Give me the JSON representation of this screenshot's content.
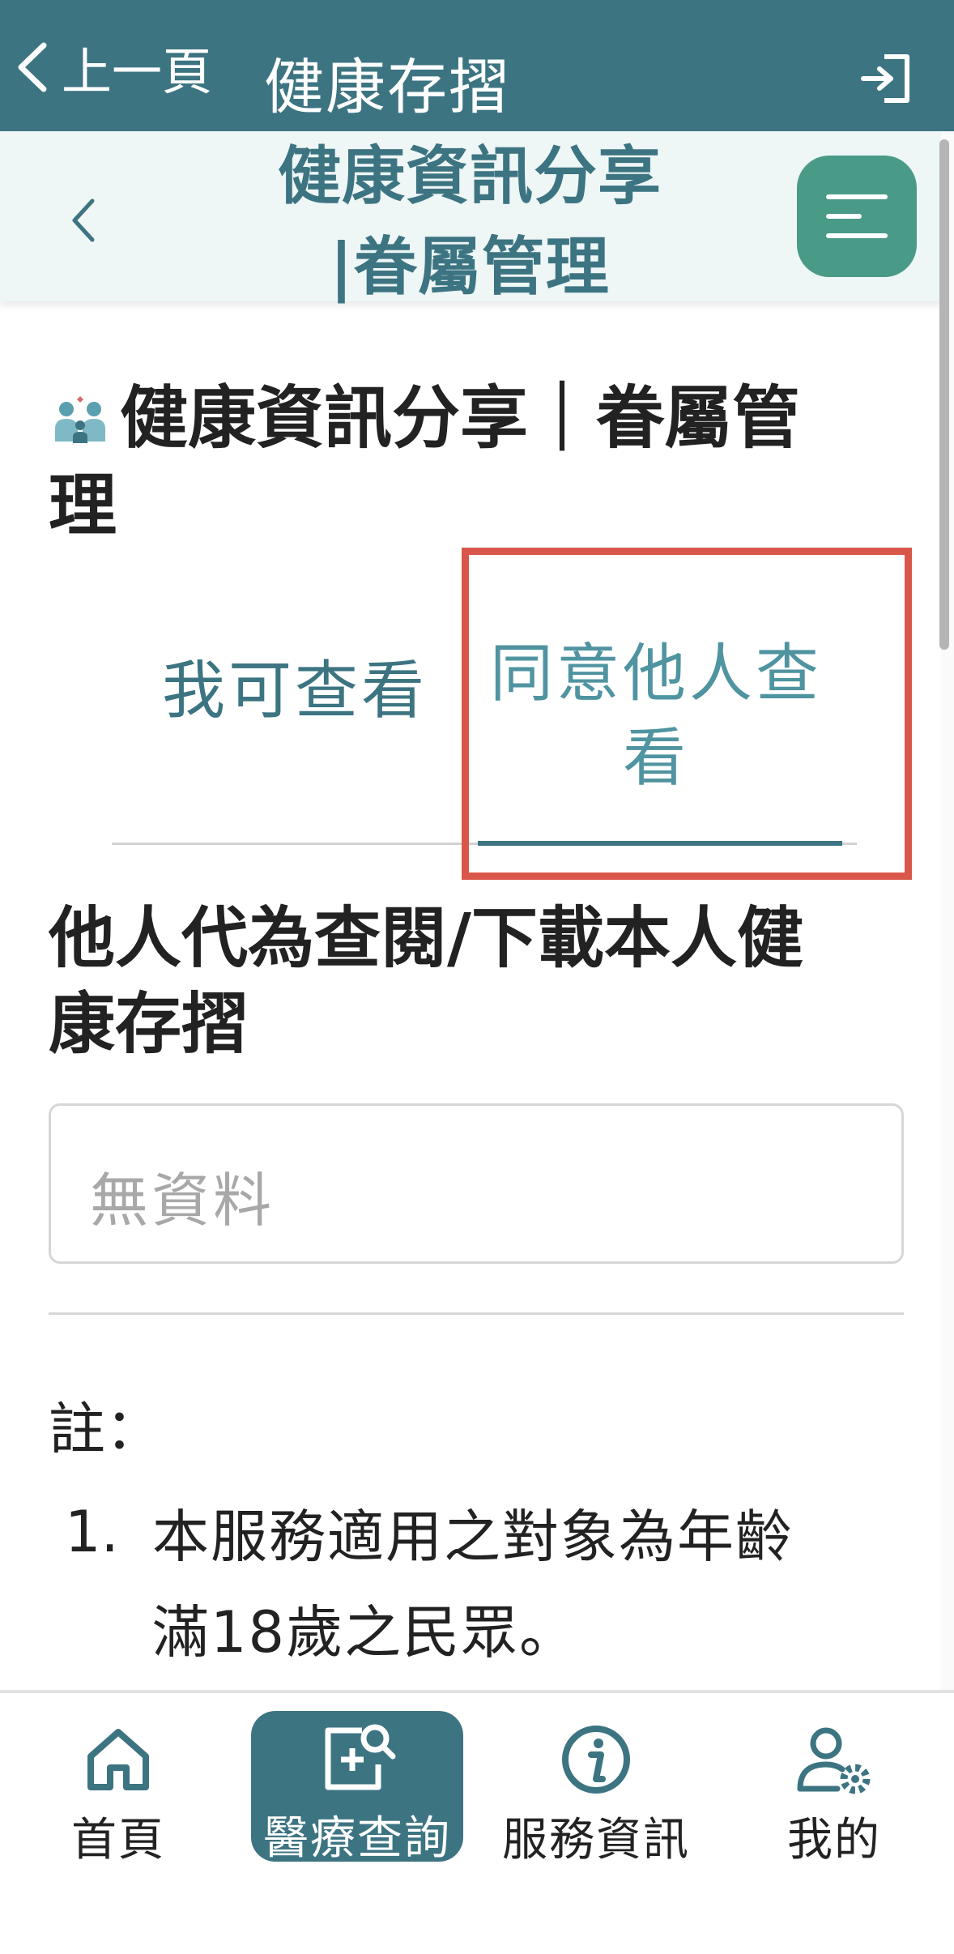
{
  "topbar": {
    "back_label": "上一頁",
    "title": "健康存摺"
  },
  "subheader": {
    "title_line1": "健康資訊分享",
    "title_line2": "|眷屬管理"
  },
  "page": {
    "heading_line1": "健康資訊分享｜眷屬管",
    "heading_line2": "理"
  },
  "tabs": {
    "mine": "我可查看",
    "others_line1": "同意他人查",
    "others_line2": "看"
  },
  "section": {
    "heading_line1": "他人代為查閱/下載本人健",
    "heading_line2": "康存摺",
    "empty_text": "無資料"
  },
  "notes": {
    "label": "註：",
    "items": [
      {
        "num": "1.",
        "line1": "本服務適用之對象為年齡",
        "line2": "滿18歲之民眾。"
      }
    ]
  },
  "nav": {
    "home": "首頁",
    "medical": "醫療查詢",
    "service": "服務資訊",
    "mine": "我的"
  },
  "colors": {
    "primary": "#3d7482",
    "accent": "#4a9a88",
    "highlight": "#d9574a"
  }
}
